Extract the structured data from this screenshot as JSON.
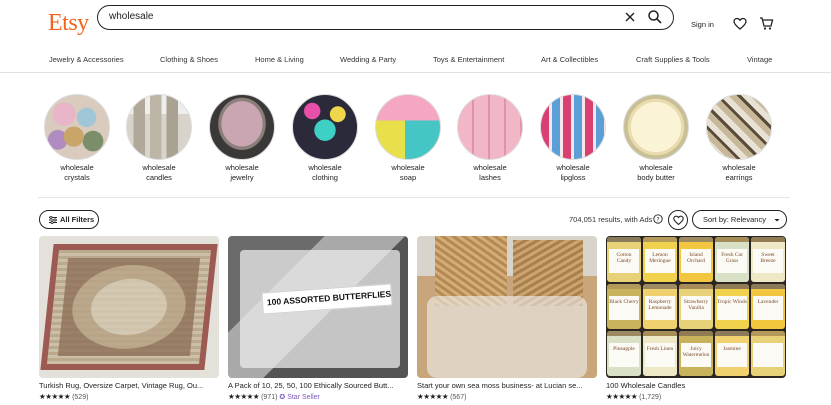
{
  "header": {
    "logo": "Etsy",
    "search": {
      "value": "wholesale"
    },
    "signin": "Sign in"
  },
  "categories": [
    "Jewelry & Accessories",
    "Clothing & Shoes",
    "Home & Living",
    "Wedding & Party",
    "Toys & Entertainment",
    "Art & Collectibles",
    "Craft Supplies & Tools",
    "Vintage"
  ],
  "circles": [
    {
      "line1": "wholesale",
      "line2": "crystals"
    },
    {
      "line1": "wholesale",
      "line2": "candles"
    },
    {
      "line1": "wholesale",
      "line2": "jewelry"
    },
    {
      "line1": "wholesale",
      "line2": "clothing"
    },
    {
      "line1": "wholesale",
      "line2": "soap"
    },
    {
      "line1": "wholesale",
      "line2": "lashes"
    },
    {
      "line1": "wholesale",
      "line2": "lipgloss"
    },
    {
      "line1": "wholesale",
      "line2": "body butter"
    },
    {
      "line1": "wholesale",
      "line2": "earrings"
    }
  ],
  "filters": {
    "all_filters": "All Filters",
    "results": "704,051 results, with Ads",
    "sort": "Sort by: Relevancy"
  },
  "listings": [
    {
      "title": "Turkish Rug, Oversize Carpet, Vintage Rug, Ou...",
      "stars": "★★★★★",
      "reviews": "(529)",
      "badge": ""
    },
    {
      "title": "A Pack of 10, 25, 50, 100 Ethically Sourced Butt...",
      "stars": "★★★★★",
      "reviews": "(971)",
      "badge": "Star Seller",
      "photo_text": "100 ASSORTED BUTTERFLIES"
    },
    {
      "title": "Start your own sea moss business- at Lucian se...",
      "stars": "★★★★★",
      "reviews": "(567)",
      "badge": ""
    },
    {
      "title": "100 Wholesale Candles",
      "stars": "★★★★★",
      "reviews": "(1,729)",
      "badge": ""
    }
  ],
  "candle_labels": [
    "Cotton Candy",
    "Lemon Meringue",
    "Island Orchard",
    "Fresh Cut Grass",
    "Sweet Breeze",
    "Black Cherry",
    "Raspberry Lemonade",
    "Strawberry Vanilla",
    "Tropic Winds",
    "Lavender",
    "Pineapple",
    "Fresh Linen",
    "Juicy Watermelon",
    "Jasmine"
  ],
  "colors": {
    "brand": "#F1641E",
    "star_seller": "#7E5BBE"
  }
}
